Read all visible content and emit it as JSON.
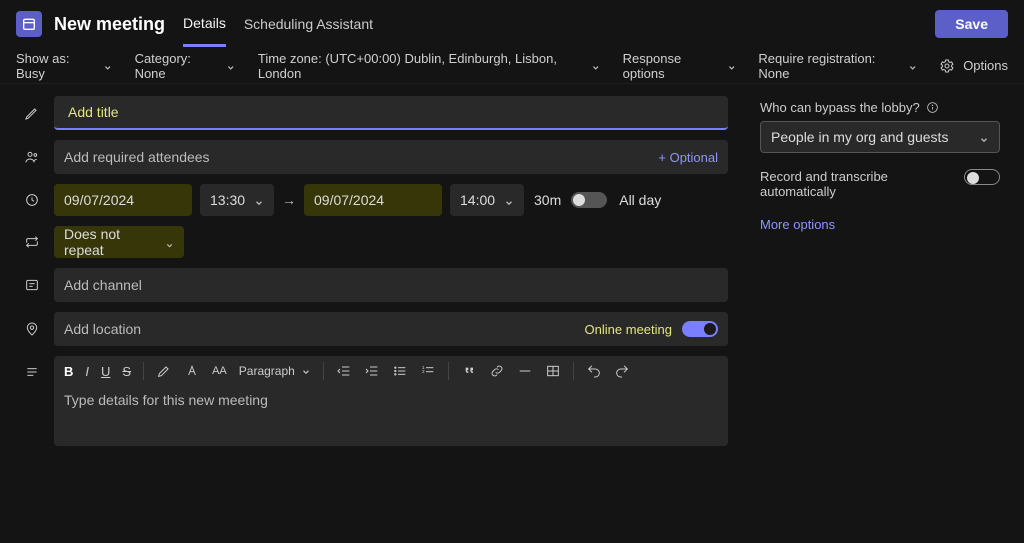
{
  "header": {
    "title": "New meeting",
    "tabDetails": "Details",
    "tabAssistant": "Scheduling Assistant",
    "save": "Save"
  },
  "ribbon": {
    "showAs": "Show as: Busy",
    "category": "Category: None",
    "timezone": "Time zone:  (UTC+00:00) Dublin, Edinburgh, Lisbon, London",
    "response": "Response options",
    "registration": "Require registration: None",
    "options": "Options"
  },
  "form": {
    "titlePlaceholder": "Add title",
    "attendeesPlaceholder": "Add required attendees",
    "optional": "+ Optional",
    "startDate": "09/07/2024",
    "startTime": "13:30",
    "endDate": "09/07/2024",
    "endTime": "14:00",
    "duration": "30m",
    "allDay": "All day",
    "repeat": "Does not repeat",
    "channelPlaceholder": "Add channel",
    "locationPlaceholder": "Add location",
    "onlineMeeting": "Online meeting",
    "paragraph": "Paragraph",
    "detailsPlaceholder": "Type details for this new meeting"
  },
  "side": {
    "lobbyLabel": "Who can bypass the lobby?",
    "lobbyValue": "People in my org and guests",
    "recordLabel": "Record and transcribe automatically",
    "more": "More options"
  }
}
